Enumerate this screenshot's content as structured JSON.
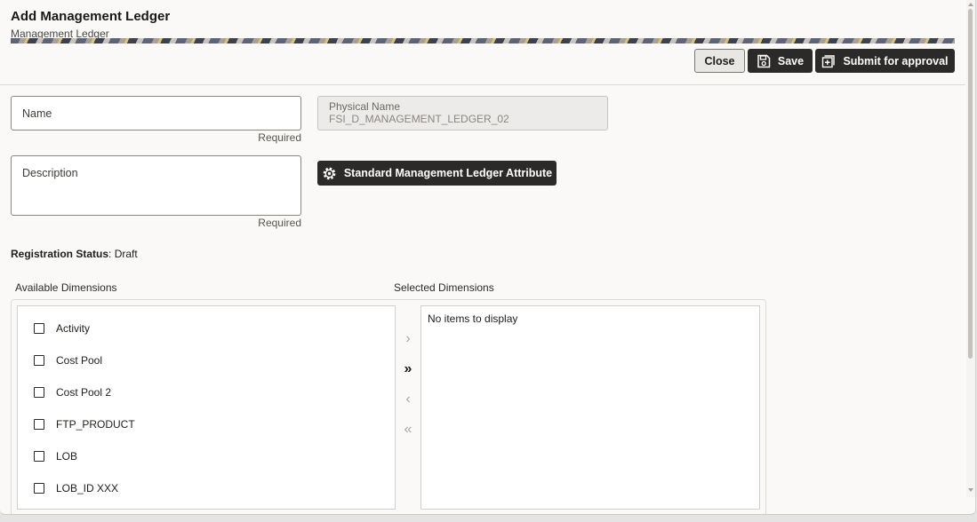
{
  "dialog": {
    "title": "Add Management Ledger",
    "subtitle": "Management Ledger"
  },
  "toolbar": {
    "close_label": "Close",
    "save_label": "Save",
    "submit_label": "Submit for approval"
  },
  "form": {
    "name_label": "Name",
    "name_required": "Required",
    "description_label": "Description",
    "description_required": "Required",
    "physical_name_label": "Physical Name",
    "physical_name_value": "FSI_D_MANAGEMENT_LEDGER_02",
    "standard_attribute_button": "Standard Management Ledger Attribute"
  },
  "registration": {
    "label": "Registration Status",
    "separator": ":",
    "value": "Draft"
  },
  "dimensions": {
    "available_label": "Available Dimensions",
    "selected_label": "Selected Dimensions",
    "available_items": [
      "Activity",
      "Cost Pool",
      "Cost Pool 2",
      "FTP_PRODUCT",
      "LOB",
      "LOB_ID XXX"
    ],
    "selected_empty_text": "No items to display",
    "move_right": "›",
    "move_all_right": "»",
    "move_left": "‹",
    "move_all_left": "«"
  },
  "icons": {
    "save": "floppy-disk-icon",
    "submit": "plus-box-icon",
    "settings": "gear-icon"
  },
  "colors": {
    "primary_button": "#2c2a28",
    "page_background": "#faf9f8"
  }
}
